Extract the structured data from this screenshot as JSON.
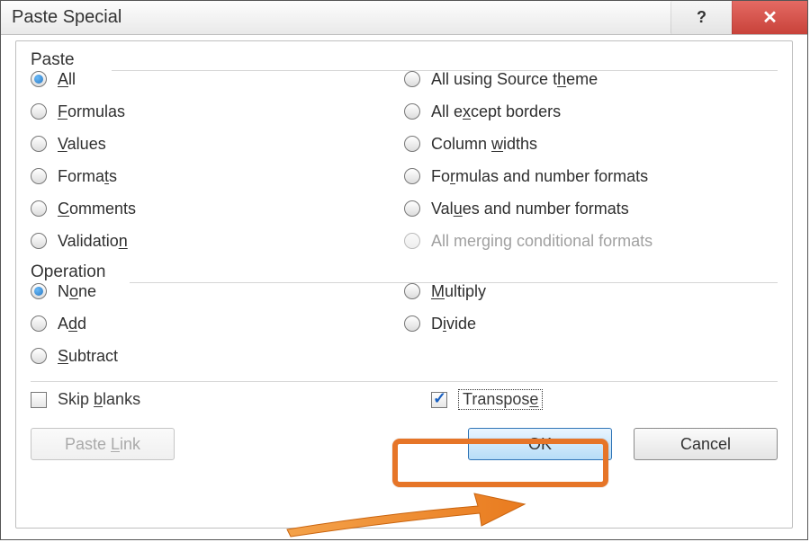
{
  "title": "Paste Special",
  "groups": {
    "paste": {
      "legend": "Paste",
      "options_left": [
        {
          "key": "all",
          "label_html": "<span class='u'>A</span>ll",
          "selected": true
        },
        {
          "key": "formulas",
          "label_html": "<span class='u'>F</span>ormulas",
          "selected": false
        },
        {
          "key": "values",
          "label_html": "<span class='u'>V</span>alues",
          "selected": false
        },
        {
          "key": "formats",
          "label_html": "Forma<span class='u'>t</span>s",
          "selected": false
        },
        {
          "key": "comments",
          "label_html": "<span class='u'>C</span>omments",
          "selected": false
        },
        {
          "key": "validation",
          "label_html": "Validatio<span class='u'>n</span>",
          "selected": false
        }
      ],
      "options_right": [
        {
          "key": "all_src_theme",
          "label_html": "All using Source t<span class='u'>h</span>eme",
          "selected": false
        },
        {
          "key": "all_except_borders",
          "label_html": "All e<span class='u'>x</span>cept borders",
          "selected": false
        },
        {
          "key": "column_widths",
          "label_html": "Column <span class='u'>w</span>idths",
          "selected": false
        },
        {
          "key": "formulas_num_formats",
          "label_html": "Fo<span class='u'>r</span>mulas and number formats",
          "selected": false
        },
        {
          "key": "values_num_formats",
          "label_html": "Val<span class='u'>u</span>es and number formats",
          "selected": false
        },
        {
          "key": "all_merging_cond",
          "label_html": "All merging conditional formats",
          "selected": false,
          "disabled": true
        }
      ]
    },
    "operation": {
      "legend": "Operation",
      "options_left": [
        {
          "key": "none",
          "label_html": "N<span class='u'>o</span>ne",
          "selected": true
        },
        {
          "key": "add",
          "label_html": "A<span class='u'>d</span>d",
          "selected": false
        },
        {
          "key": "subtract",
          "label_html": "<span class='u'>S</span>ubtract",
          "selected": false
        }
      ],
      "options_right": [
        {
          "key": "multiply",
          "label_html": "<span class='u'>M</span>ultiply",
          "selected": false
        },
        {
          "key": "divide",
          "label_html": "D<span class='u'>i</span>vide",
          "selected": false
        }
      ]
    }
  },
  "checks": {
    "skip_blanks": {
      "label_html": "Skip <span class='u'>b</span>lanks",
      "checked": false
    },
    "transpose": {
      "label_html": "Transpos<span class='u'>e</span>",
      "checked": true,
      "focused": true
    }
  },
  "buttons": {
    "paste_link": {
      "label": "Paste Link",
      "disabled": true,
      "underline": "L"
    },
    "ok": {
      "label": "OK",
      "default": true
    },
    "cancel": {
      "label": "Cancel"
    }
  },
  "annotations": {
    "highlight": "transpose",
    "arrow_target": "ok"
  }
}
